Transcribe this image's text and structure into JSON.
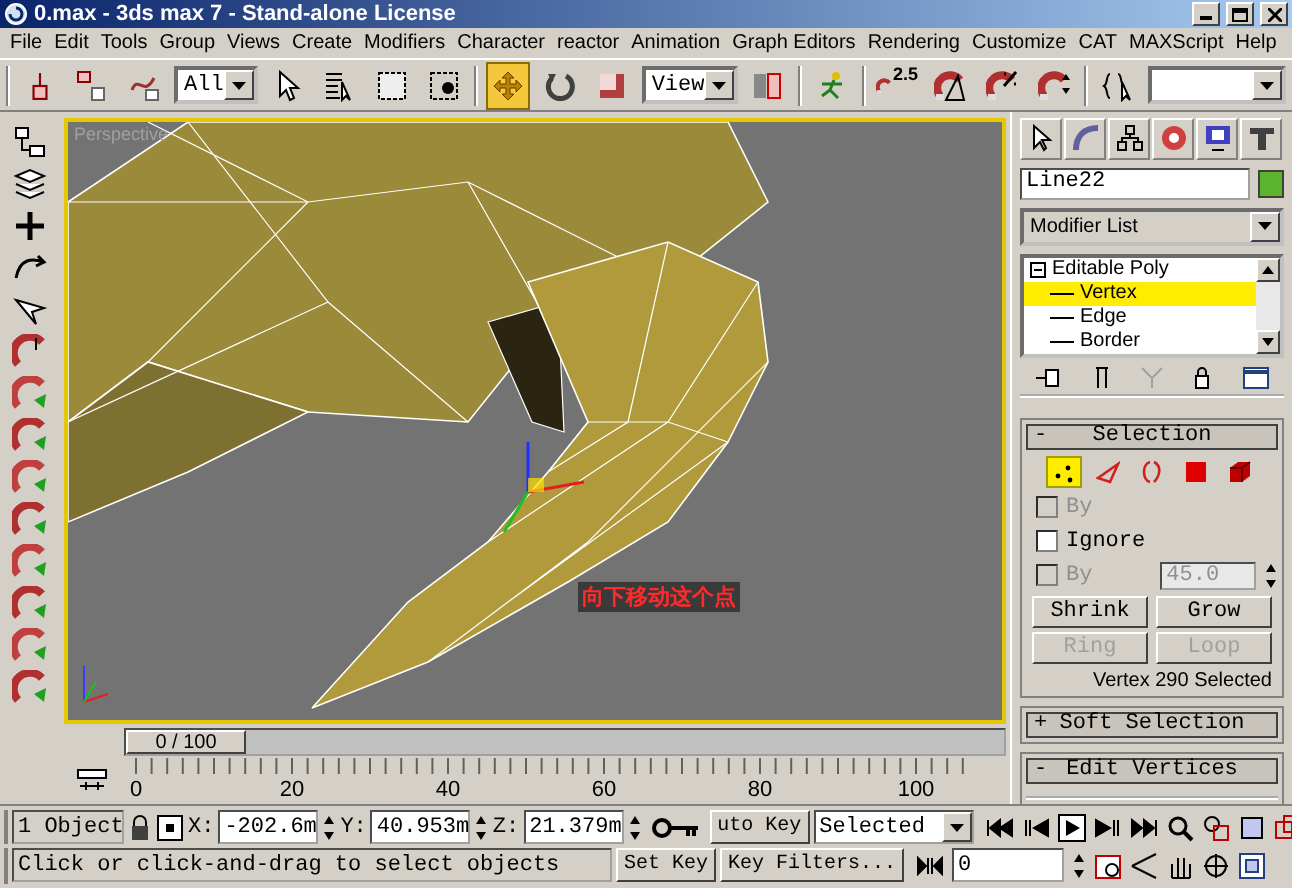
{
  "window": {
    "title": "0.max - 3ds max 7  - Stand-alone License"
  },
  "menu": [
    "File",
    "Edit",
    "Tools",
    "Group",
    "Views",
    "Create",
    "Modifiers",
    "Character",
    "reactor",
    "Animation",
    "Graph Editors",
    "Rendering",
    "Customize",
    "CAT",
    "MAXScript",
    "Help"
  ],
  "toolbar": {
    "selection_filter": "All",
    "reference_coord": "View",
    "snap_value": "2.5",
    "move_selected": true
  },
  "viewport": {
    "label": "Perspective",
    "annotation": "向下移动这个点"
  },
  "time_slider": {
    "label": "0 / 100",
    "level": 0
  },
  "ruler": {
    "labels": [
      "0",
      "20",
      "40",
      "60",
      "80",
      "100"
    ]
  },
  "command_panel": {
    "object_name": "Line22",
    "modifier_list": "Modifier List",
    "stack": [
      {
        "label": "Editable Poly",
        "expanded": true,
        "selected": false,
        "children": [
          {
            "label": "Vertex",
            "selected": true
          },
          {
            "label": "Edge",
            "selected": false
          },
          {
            "label": "Border",
            "selected": false
          }
        ]
      }
    ],
    "rollouts": [
      {
        "title": "Selection",
        "toggle": "-",
        "expanded": true
      },
      {
        "title": "Soft Selection",
        "toggle": "+",
        "expanded": false
      },
      {
        "title": "Edit Vertices",
        "toggle": "-",
        "expanded": true
      }
    ],
    "subobject_levels": [
      {
        "kind": "vertex",
        "selected": true
      },
      {
        "kind": "edge",
        "selected": false
      },
      {
        "kind": "border",
        "selected": false
      },
      {
        "kind": "polygon",
        "selected": false
      },
      {
        "kind": "element",
        "selected": false
      }
    ],
    "options": [
      {
        "label": "By",
        "checked": false,
        "disabled": true
      },
      {
        "label": "Ignore",
        "checked": false,
        "disabled": false
      },
      {
        "label": "By",
        "checked": false,
        "disabled": true
      }
    ],
    "angle": "45.0",
    "buttons": [
      {
        "label": "Shrink",
        "disabled": false
      },
      {
        "label": "Grow",
        "disabled": false
      },
      {
        "label": "Ring",
        "disabled": true
      },
      {
        "label": "Loop",
        "disabled": true
      }
    ],
    "status": "Vertex 290 Selected"
  },
  "status_bar": {
    "selection": "1 Object",
    "coords": [
      {
        "label": "X:",
        "value": "-202.6m"
      },
      {
        "label": "Y:",
        "value": "40.953m"
      },
      {
        "label": "Z:",
        "value": "21.379m"
      }
    ],
    "auto_key": "uto Key",
    "key_mode": "Selected",
    "set_key": "Set Key",
    "key_filters": "Key Filters...",
    "frame": "0",
    "prompt": "Click or click-and-drag to select objects"
  }
}
